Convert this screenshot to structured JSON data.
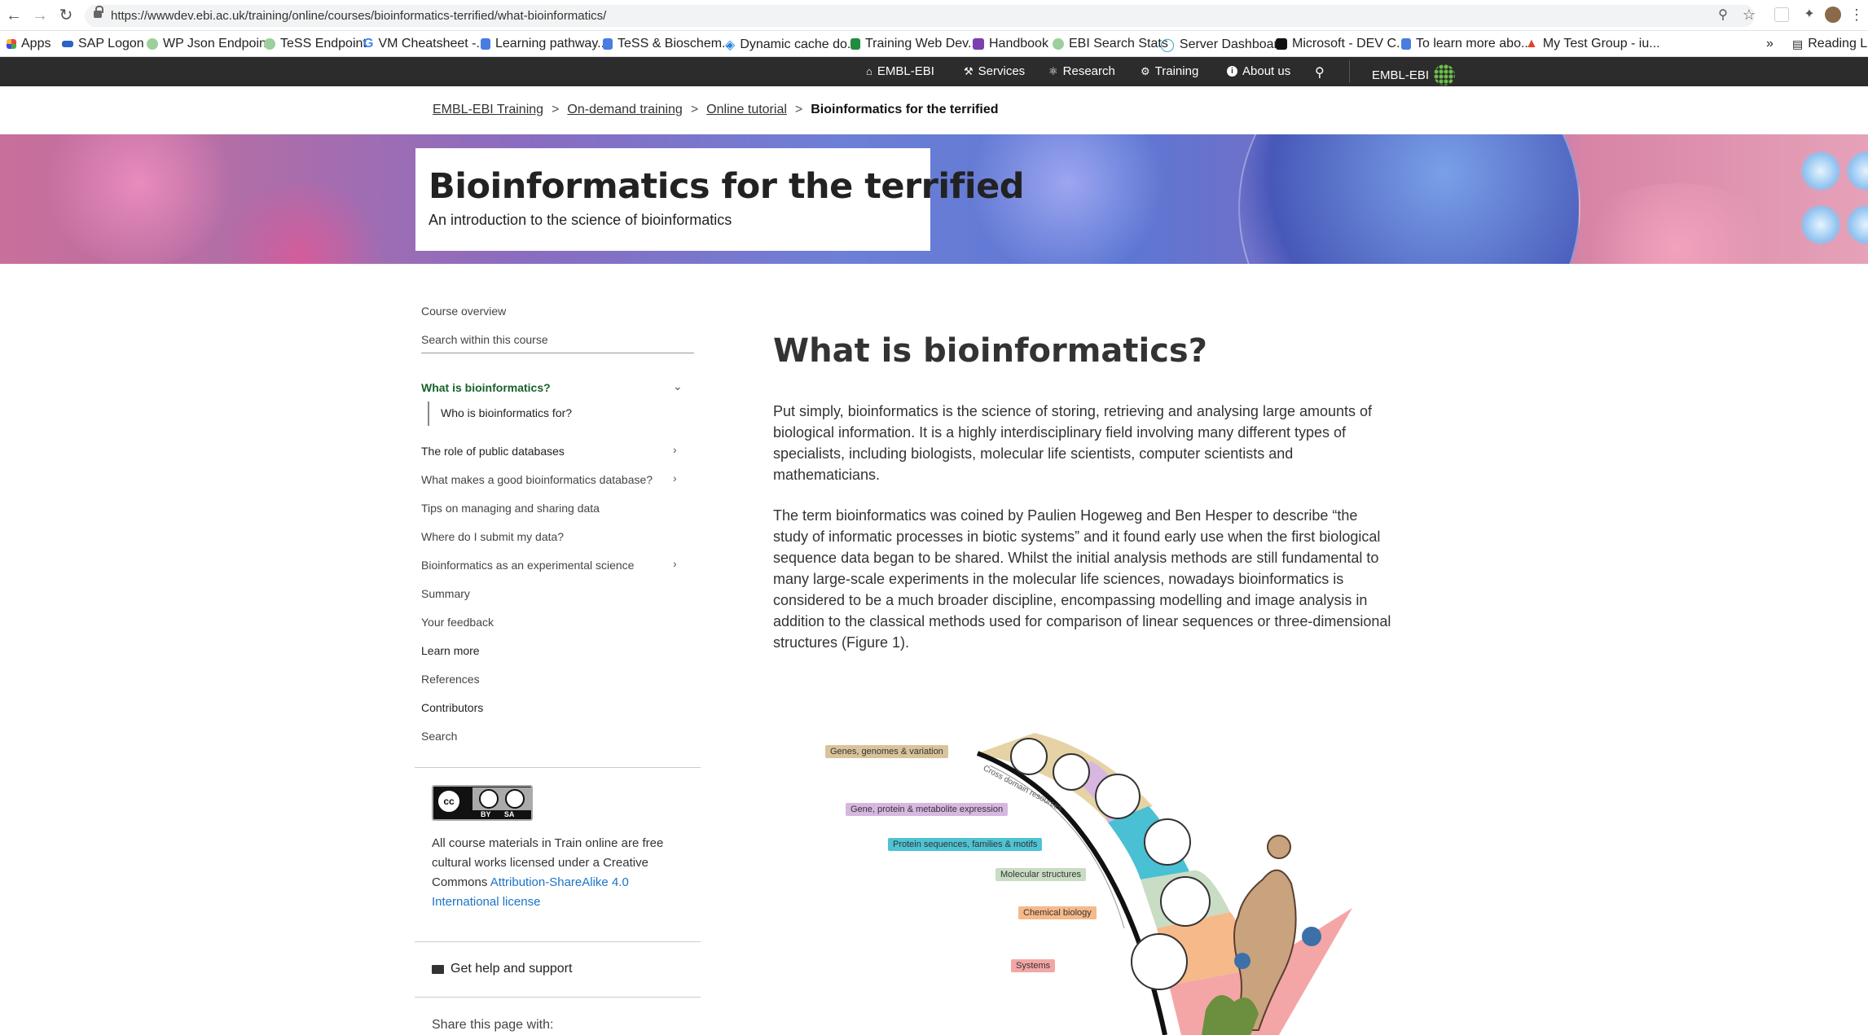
{
  "browser": {
    "url": "https://wwwdev.ebi.ac.uk/training/online/courses/bioinformatics-terrified/what-bioinformatics/",
    "bookmarks": [
      "Apps",
      "SAP Logon",
      "WP Json Endpoint",
      "TeSS Endpoint",
      "VM Cheatsheet -...",
      "Learning pathway...",
      "TeSS & Bioschem...",
      "Dynamic cache do...",
      "Training Web Dev...",
      "Handbook",
      "EBI Search Stats",
      "Server Dashboard",
      "Microsoft - DEV C...",
      "To learn more abo...",
      "My Test Group - iu..."
    ],
    "overflow": "»",
    "reading_list": "Reading List"
  },
  "sitenav": {
    "items": [
      "EMBL-EBI",
      "Services",
      "Research",
      "Training",
      "About us"
    ],
    "brand": "EMBL-EBI"
  },
  "breadcrumb": {
    "links": [
      "EMBL-EBI Training",
      "On-demand training",
      "Online tutorial"
    ],
    "current": "Bioinformatics for the terrified"
  },
  "banner": {
    "title": "Bioinformatics for the terrified",
    "subtitle": "An introduction to the science of bioinformatics"
  },
  "sidebar": {
    "overview": "Course overview",
    "search_placeholder": "Search within this course",
    "items": [
      {
        "label": "What is bioinformatics?",
        "active": true
      },
      {
        "label": "Who is bioinformatics for?"
      },
      {
        "label": "The role of public databases"
      },
      {
        "label": "What makes a good bioinformatics database?"
      },
      {
        "label": "Tips on managing and sharing data"
      },
      {
        "label": "Where do I submit my data?"
      },
      {
        "label": "Bioinformatics as an experimental science"
      },
      {
        "label": "Summary"
      },
      {
        "label": "Your feedback"
      },
      {
        "label": "Learn more"
      },
      {
        "label": "References"
      },
      {
        "label": "Contributors"
      },
      {
        "label": "Search"
      }
    ],
    "license_badge": "BY SA",
    "license_text": "All course materials in Train online are free cultural works licensed under a Creative Commons ",
    "license_link": "Attribution-ShareAlike 4.0 International license",
    "help": "Get help and support",
    "share": "Share this page with:"
  },
  "main": {
    "heading": "What is bioinformatics?",
    "p1": "Put simply, bioinformatics is the science of storing, retrieving and analysing large amounts of biological information. It is a highly interdisciplinary field involving many different types of specialists, including biologists, molecular life scientists, computer scientists and mathematicians.",
    "p2": "The term bioinformatics was coined by Paulien Hogeweg and Ben Hesper to describe “the study of informatic processes in biotic systems” and it found early use when the first biological sequence data began to be shared. Whilst the initial analysis methods are still fundamental to many large-scale experiments in the molecular life sciences, nowadays bioinformatics is considered to be a much broader discipline, encompassing modelling and image analysis in addition to the classical methods used for comparison of linear sequences or three-dimensional structures (Figure 1)."
  },
  "figure": {
    "labels": [
      "Genes, genomes & variation",
      "Gene, protein & metabolite expression",
      "Protein sequences, families & motifs",
      "Molecular structures",
      "Chemical biology",
      "Systems"
    ],
    "label_colors": [
      "#d9c39a",
      "#d7b7e0",
      "#4fc3d3",
      "#c9dcc4",
      "#f6b98a",
      "#f4a6a6"
    ],
    "arc_text": "Cross domain resources"
  },
  "colors": {
    "sitenav_bg": "#2c2c2c",
    "active_green": "#18612b",
    "link_blue": "#1a74c7"
  }
}
